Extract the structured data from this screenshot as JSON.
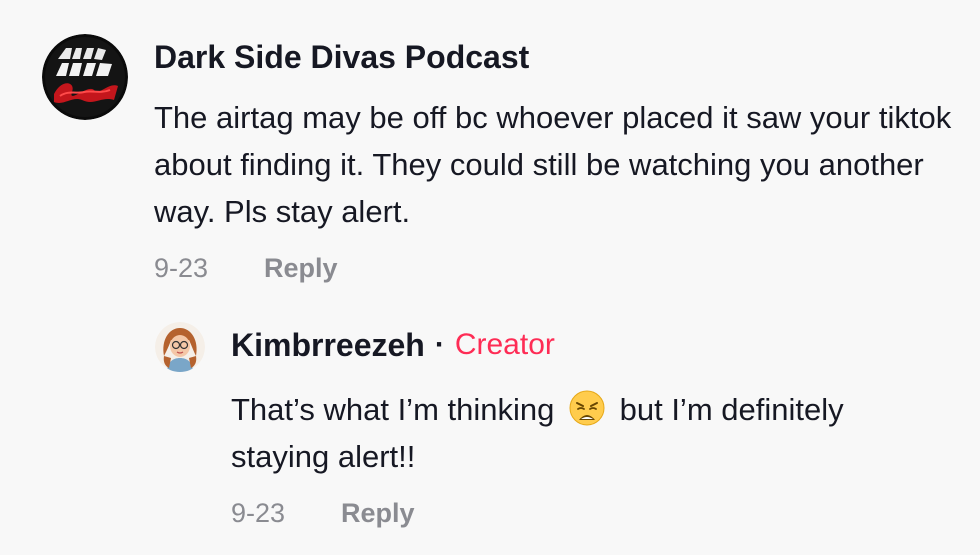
{
  "comments": [
    {
      "author": "Dark Side Divas Podcast",
      "avatar_icon": "dark-side-divas-logo",
      "text": "The airtag may be off bc whoever placed it saw your tiktok about finding it. They could still be watching you another way. Pls stay alert.",
      "date": "9-23",
      "reply_label": "Reply"
    },
    {
      "author": "Kimbrreezeh",
      "separator": "·",
      "badge": "Creator",
      "avatar_icon": "cartoon-girl-avatar",
      "text_before": "That’s what I’m thinking",
      "emoji": "weary-face-emoji",
      "text_after": "but I’m definitely staying alert!!",
      "date": "9-23",
      "reply_label": "Reply"
    }
  ],
  "colors": {
    "background": "#f8f8f8",
    "primary_text": "#161823",
    "secondary_text": "#8a8b91",
    "creator_badge": "#fe2c55"
  }
}
